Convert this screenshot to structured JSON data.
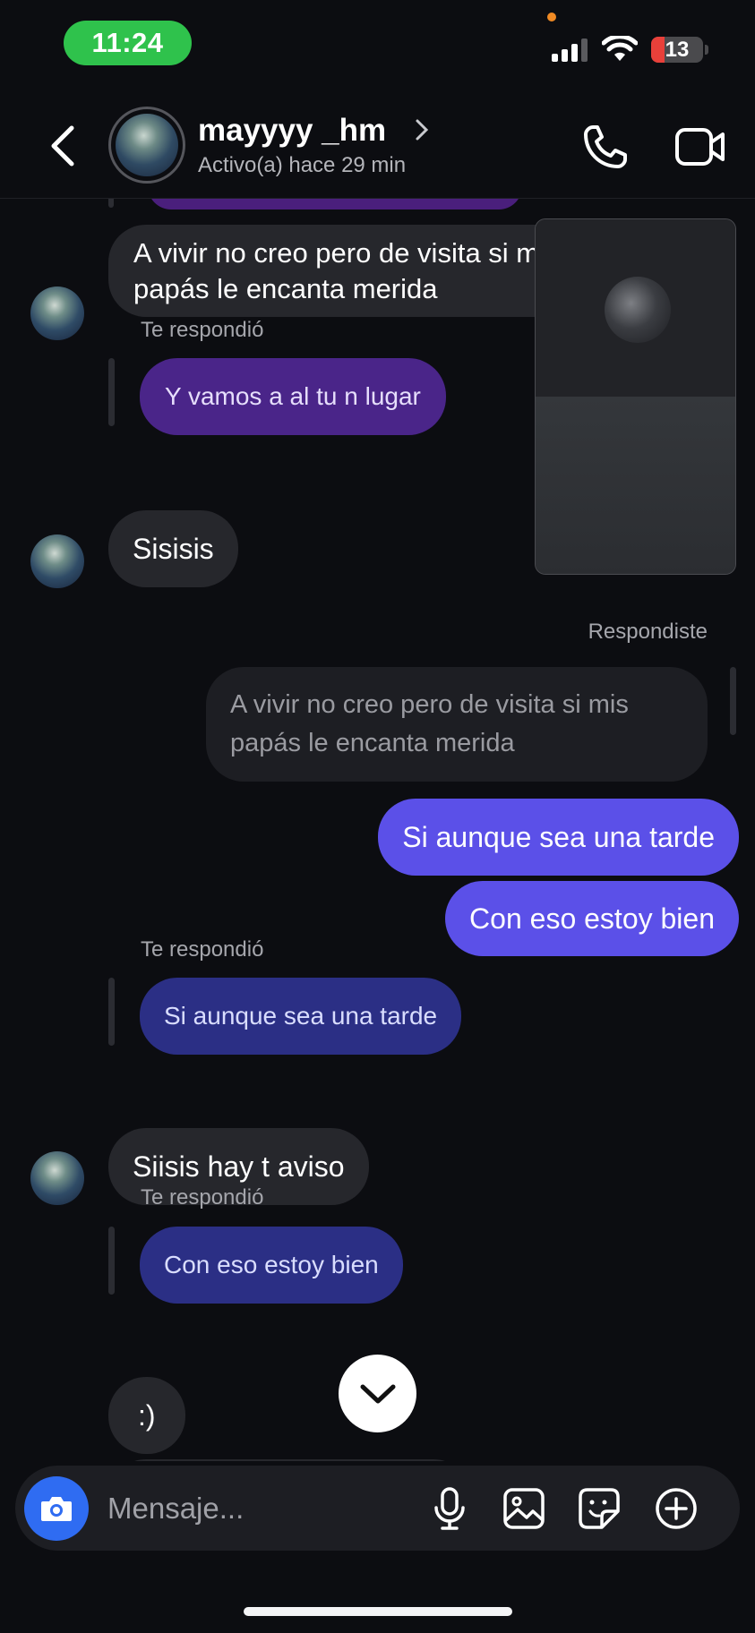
{
  "status_bar": {
    "time": "11:24",
    "battery": "13"
  },
  "header": {
    "username": "mayyyy _hm",
    "active_status": "Activo(a) hace 29 min"
  },
  "messages": {
    "m1": "A vivir no creo pero de visita si mis papás le encanta merida",
    "reply_label": "Te respondió",
    "reply1_quote": "Y vamos a al tu n lugar",
    "m2": "Sisisis",
    "sent_reply_label": "Respondiste",
    "sent_quote": "A vivir no creo pero de visita si mis papás le encanta merida",
    "sent1": "Si aunque sea una tarde",
    "sent2": "Con eso estoy bien",
    "reply2_quote": "Si aunque sea una tarde",
    "m3": "Siisis hay t aviso",
    "reply3_quote": "Con eso estoy bien",
    "m4": ":)"
  },
  "composer": {
    "placeholder": "Mensaje..."
  },
  "icons": {
    "back": "chevron-left-icon",
    "call": "phone-icon",
    "video": "video-camera-icon",
    "camera": "camera-icon",
    "mic": "microphone-icon",
    "gallery": "image-icon",
    "sticker": "sticker-icon",
    "more": "plus-circle-icon",
    "scroll": "chevron-down-icon"
  },
  "colors": {
    "background": "#0c0d11",
    "received_bubble": "#26272c",
    "sent_bubble": "#5b50e8",
    "camera_button": "#2f6cf2",
    "status_time_pill": "#2fc24c"
  }
}
